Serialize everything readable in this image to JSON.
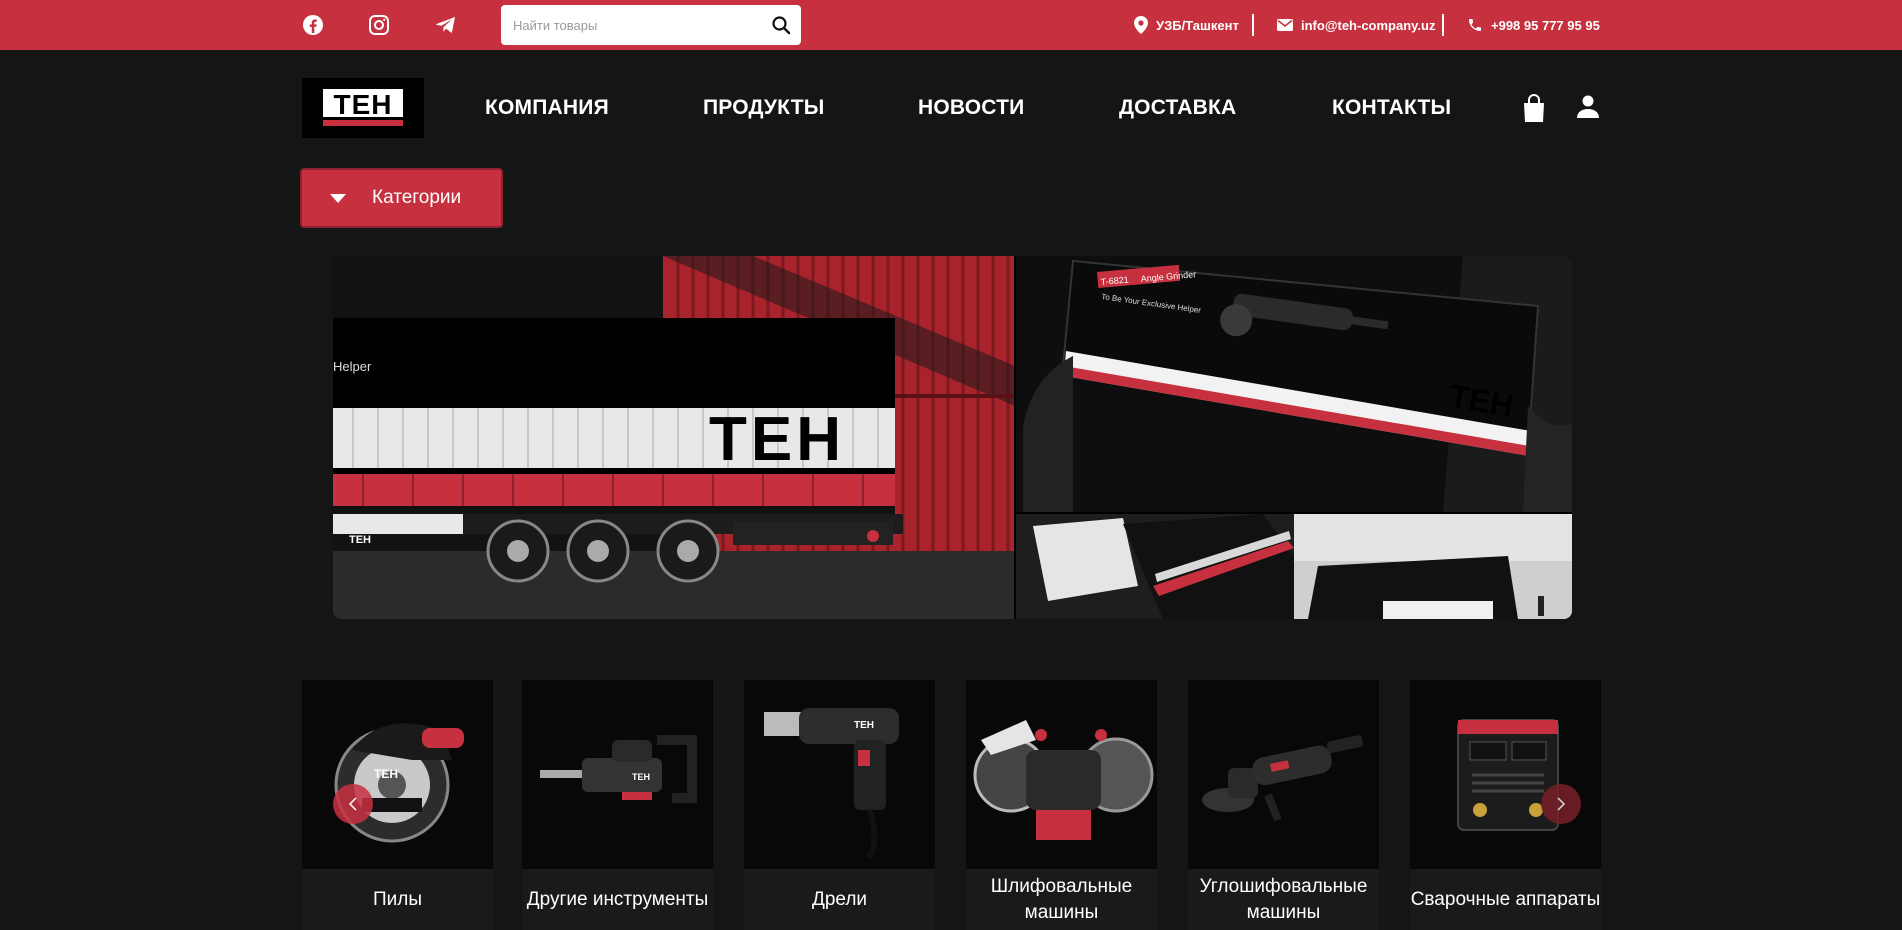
{
  "topbar": {
    "social": [
      {
        "icon": "facebook-icon"
      },
      {
        "icon": "instagram-icon"
      },
      {
        "icon": "telegram-icon"
      }
    ],
    "search_placeholder": "Найти товары",
    "location": "УЗБ/Ташкент",
    "email": "info@teh-company.uz",
    "phone": "+998 95 777 95 95"
  },
  "header": {
    "logo_text": "TEH",
    "nav": [
      "КОМПАНИЯ",
      "ПРОДУКТЫ",
      "НОВОСТИ",
      "ДОСТАВКА",
      "КОНТАКТЫ"
    ],
    "categories_label": "Категории"
  },
  "banner": {
    "trailer_brand": "TEH",
    "trailer_text": "Helper",
    "box_model": "T-6821",
    "box_title": "Angle Grinder",
    "box_slogan": "To Be Your Exclusive Helper",
    "box_brand": "TEH"
  },
  "categories": [
    {
      "label": "Пилы",
      "icon": "circular-saw-image"
    },
    {
      "label": "Другие инструменты",
      "icon": "demolition-hammer-image"
    },
    {
      "label": "Дрели",
      "icon": "drill-image"
    },
    {
      "label": "Шлифовальные машины",
      "icon": "bench-grinder-image"
    },
    {
      "label": "Углошифовальные машины",
      "icon": "angle-grinder-image"
    },
    {
      "label": "Сварочные аппараты",
      "icon": "welding-machine-image"
    }
  ],
  "colors": {
    "accent": "#c7313f",
    "background": "#141515",
    "card": "#1a1a1a"
  }
}
